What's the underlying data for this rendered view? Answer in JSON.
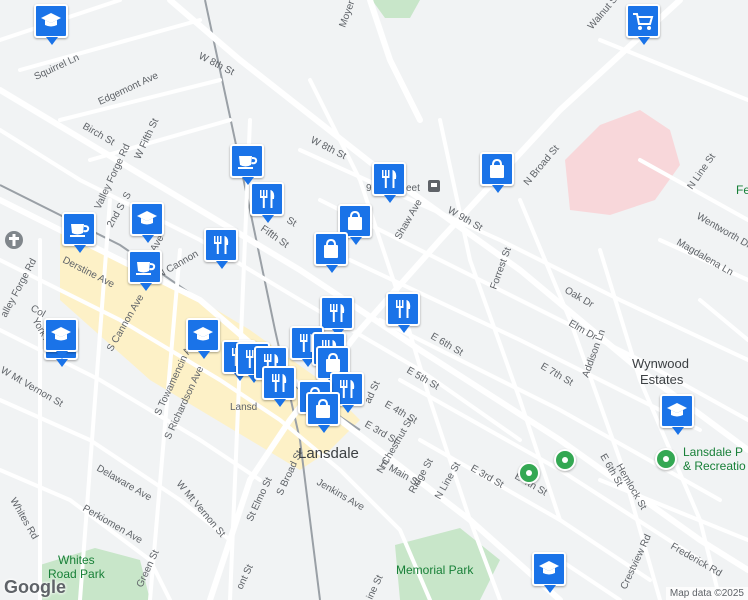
{
  "map": {
    "attribution": "Map data ©2025",
    "logo": "Google",
    "colors": {
      "road": "#ffffff",
      "rail": "#9aa0a6",
      "park": "#c8e6c9",
      "pin": "#1a73e8",
      "hospital": "#f8d7da",
      "downtown": "#fdf1c7"
    }
  },
  "labels": {
    "city": "Lansdale",
    "city_partial": "Lansd",
    "wynwood_1": "Wynwood",
    "wynwood_2": "Estates",
    "whites_1": "Whites",
    "whites_2": "Road Park",
    "memorial": "Memorial Park",
    "lansdale_p": "Lansdale P",
    "recreation": "& Recreatio",
    "ninth_partial": "9",
    "et": "eet",
    "fe": "Fe"
  },
  "streets": [
    {
      "name": "W 8th St"
    },
    {
      "name": "Squirrel Ln"
    },
    {
      "name": "Edgemont Ave"
    },
    {
      "name": "Birch St"
    },
    {
      "name": "W Fifth St"
    },
    {
      "name": "Valley Forge Rd"
    },
    {
      "name": "W 8th St"
    },
    {
      "name": "N Cannon"
    },
    {
      "name": "Derstine Ave"
    },
    {
      "name": "York Ave"
    },
    {
      "name": "S Cannon Ave"
    },
    {
      "name": "S Towamencin Ave"
    },
    {
      "name": "S Richardson Ave"
    },
    {
      "name": "W Mt Vernon St"
    },
    {
      "name": "Delaware Ave"
    },
    {
      "name": "Perkiomen Ave"
    },
    {
      "name": "Whites Rd"
    },
    {
      "name": "W Mt Vernon St"
    },
    {
      "name": "St Elmo St"
    },
    {
      "name": "S Broad St"
    },
    {
      "name": "Jenkins Ave"
    },
    {
      "name": "E Main St"
    },
    {
      "name": "Green St"
    },
    {
      "name": "Moyer Rd"
    },
    {
      "name": "Shaw Ave"
    },
    {
      "name": "W 9th St"
    },
    {
      "name": "N Broad St"
    },
    {
      "name": "Walnut St"
    },
    {
      "name": "Forrest St"
    },
    {
      "name": "Oak Dr"
    },
    {
      "name": "Elm Dr"
    },
    {
      "name": "E 6th St"
    },
    {
      "name": "E 5th St"
    },
    {
      "name": "E 4th St"
    },
    {
      "name": "E 3rd St"
    },
    {
      "name": "N Chestnut St"
    },
    {
      "name": "Ridge St"
    },
    {
      "name": "N Line St"
    },
    {
      "name": "E 3rd St"
    },
    {
      "name": "E 4th St"
    },
    {
      "name": "E 7th St"
    },
    {
      "name": "Addison Ln"
    },
    {
      "name": "Magdalena Ln"
    },
    {
      "name": "Wentworth Dr"
    },
    {
      "name": "N Line St"
    },
    {
      "name": "Hemlock St"
    },
    {
      "name": "E 6th St"
    },
    {
      "name": "Frederick Rd"
    },
    {
      "name": "Crestview Rd"
    },
    {
      "name": "Fifth St"
    },
    {
      "name": "S"
    },
    {
      "name": "St"
    },
    {
      "name": "Col"
    },
    {
      "name": "ad St"
    },
    {
      "name": "ont St"
    },
    {
      "name": "ine St"
    },
    {
      "name": "ll Ave"
    },
    {
      "name": "2nd S"
    },
    {
      "name": "alley Forge Rd"
    }
  ],
  "pins": [
    {
      "icon": "school-icon"
    },
    {
      "icon": "grocery-icon"
    },
    {
      "icon": "cafe-icon"
    },
    {
      "icon": "restaurant-icon"
    },
    {
      "icon": "restaurant-icon"
    },
    {
      "icon": "shopping-icon"
    },
    {
      "icon": "shopping-icon"
    },
    {
      "icon": "school-icon"
    },
    {
      "icon": "cafe-icon"
    },
    {
      "icon": "cafe-icon"
    },
    {
      "icon": "restaurant-icon"
    },
    {
      "icon": "shopping-icon"
    },
    {
      "icon": "restaurant-icon"
    },
    {
      "icon": "school-icon"
    },
    {
      "icon": "school-icon"
    },
    {
      "icon": "restaurant-icon"
    },
    {
      "icon": "restaurant-icon"
    },
    {
      "icon": "restaurant-icon"
    },
    {
      "icon": "school-icon"
    },
    {
      "icon": "restaurant-icon"
    },
    {
      "icon": "restaurant-icon"
    },
    {
      "icon": "restaurant-icon"
    },
    {
      "icon": "shopping-icon"
    },
    {
      "icon": "restaurant-icon"
    },
    {
      "icon": "restaurant-icon"
    },
    {
      "icon": "shopping-icon"
    },
    {
      "icon": "shopping-icon"
    },
    {
      "icon": "school-icon"
    },
    {
      "icon": "school-icon"
    }
  ]
}
